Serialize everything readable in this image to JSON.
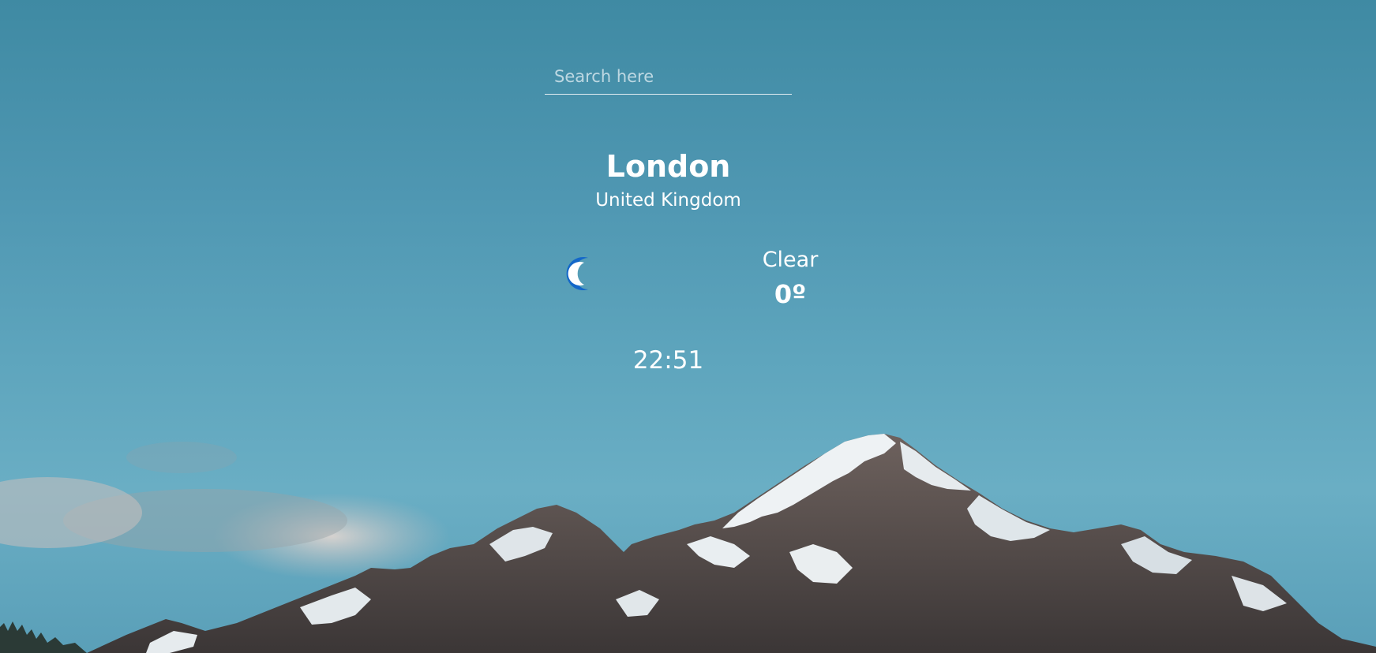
{
  "search": {
    "placeholder": "Search here",
    "value": ""
  },
  "location": {
    "city": "London",
    "country": "United Kingdom"
  },
  "weather": {
    "icon": "moon-icon",
    "condition": "Clear",
    "temperature": "0º"
  },
  "clock": {
    "time": "22:51"
  },
  "colors": {
    "sky": "#4f97b2",
    "moon": "#1467c9",
    "text": "#ffffff"
  }
}
